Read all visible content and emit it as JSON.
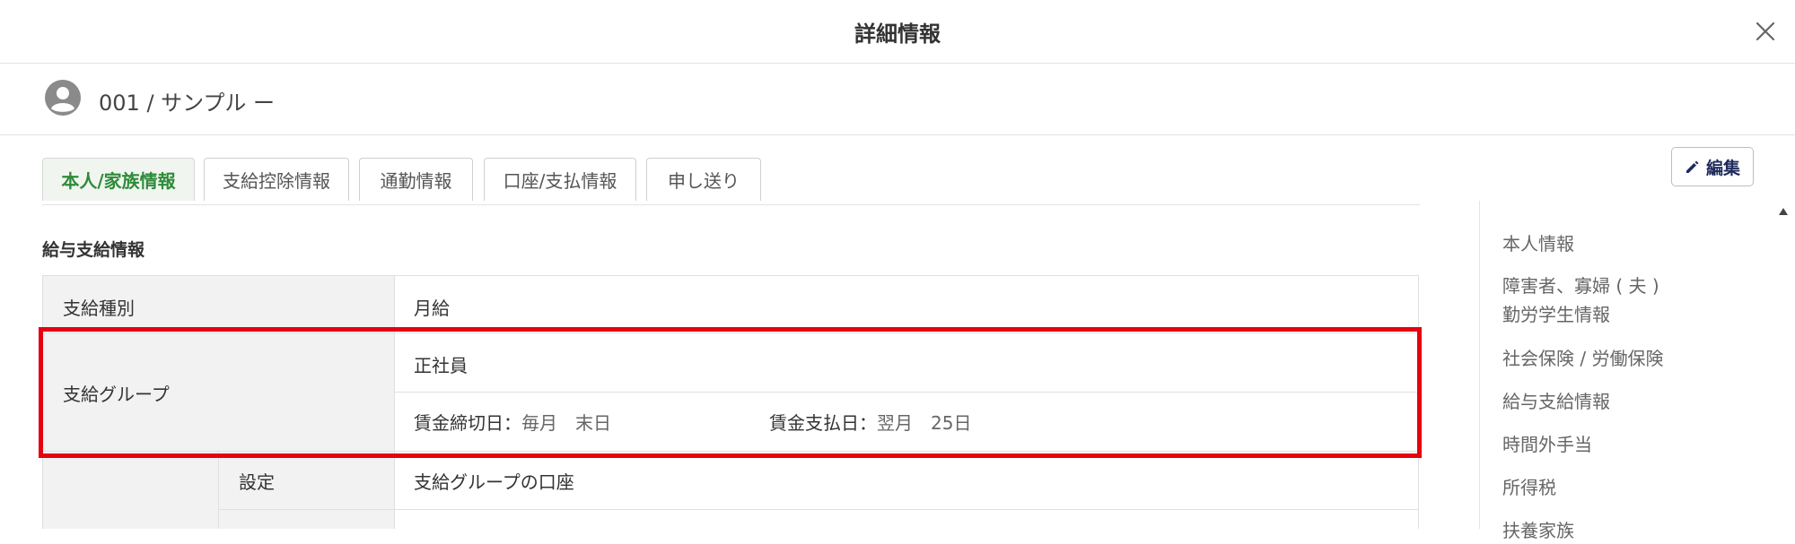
{
  "header": {
    "title": "詳細情報"
  },
  "person": {
    "name": "001 / サンプル ー"
  },
  "tabs": [
    {
      "label": "本人/家族情報"
    },
    {
      "label": "支給控除情報"
    },
    {
      "label": "通勤情報"
    },
    {
      "label": "口座/支払情報"
    },
    {
      "label": "申し送り"
    }
  ],
  "toolbar": {
    "edit_label": "編集"
  },
  "section": {
    "title": "給与支給情報"
  },
  "table": {
    "rows": [
      {
        "label": "支給種別",
        "value": "月給"
      },
      {
        "label": "支給グループ",
        "value": "正社員",
        "closing_label": "賃金締切日：",
        "closing_value": "毎月　末日",
        "payday_label": "賃金支払日：",
        "payday_value": "翌月　25日"
      },
      {
        "sub_label": "設定",
        "value": "支給グループの口座"
      }
    ]
  },
  "side_nav": {
    "items": [
      {
        "label": "本人情報"
      },
      {
        "label": "障害者、寡婦 ( 夫 )"
      },
      {
        "label": "勤労学生情報"
      },
      {
        "label": "社会保険 / 労働保険"
      },
      {
        "label": "給与支給情報"
      },
      {
        "label": "時間外手当"
      },
      {
        "label": "所得税"
      },
      {
        "label": "扶養家族"
      }
    ]
  },
  "colors": {
    "accent_green": "#2e8b3a",
    "highlight_red": "#e60012",
    "edit_navy": "#1f2a5c"
  }
}
